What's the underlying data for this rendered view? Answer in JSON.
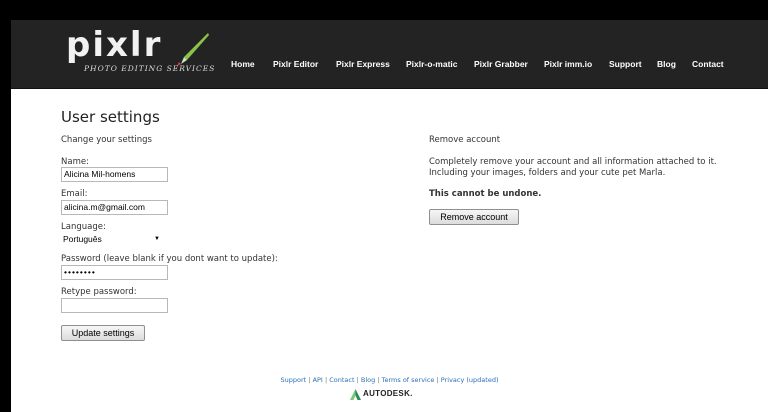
{
  "logo": {
    "name": "pixlr",
    "tagline": "PHOTO EDITING SERVICES"
  },
  "nav": [
    {
      "label": "Home"
    },
    {
      "label": "Pixlr Editor"
    },
    {
      "label": "Pixlr Express"
    },
    {
      "label": "Pixlr-o-matic"
    },
    {
      "label": "Pixlr Grabber"
    },
    {
      "label": "Pixlr imm.io"
    },
    {
      "label": "Support"
    },
    {
      "label": "Blog"
    },
    {
      "label": "Contact"
    }
  ],
  "page": {
    "title": "User settings",
    "subtitle": "Change your settings"
  },
  "form": {
    "name_label": "Name:",
    "name_value": "Alicina Mil-homens",
    "email_label": "Email:",
    "email_value": "alicina.m@gmail.com",
    "language_label": "Language:",
    "language_value": "Português",
    "password_label": "Password (leave blank if you dont want to update):",
    "password_value": "••••••••",
    "retype_label": "Retype password:",
    "retype_value": "",
    "submit_label": "Update settings"
  },
  "remove": {
    "heading": "Remove account",
    "desc_line1": "Completely remove your account and all information attached to it.",
    "desc_line2": "Including your images, folders and your cute pet Marla.",
    "warning": "This cannot be undone.",
    "button_label": "Remove account"
  },
  "footer": {
    "links": [
      "Support",
      "API",
      "Contact",
      "Blog",
      "Terms of service",
      "Privacy (updated)"
    ],
    "separator": "|",
    "brand": "AUTODESK."
  },
  "colors": {
    "header_bg": "#232323",
    "footer_link": "#2a6ebb",
    "autodesk_green": "#4aa564"
  }
}
